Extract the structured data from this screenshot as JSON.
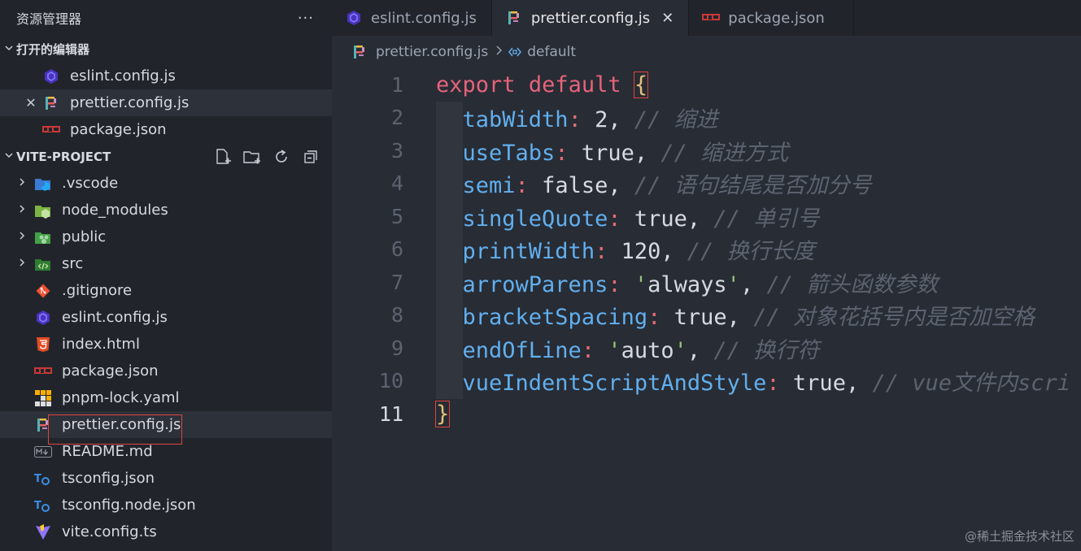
{
  "sidebar": {
    "title": "资源管理器",
    "more": "···",
    "open_editors": {
      "label": "打开的编辑器",
      "items": [
        {
          "name": "eslint.config.js",
          "icon": "eslint-icon"
        },
        {
          "name": "prettier.config.js",
          "icon": "prettier-icon",
          "active": true,
          "close": "✕"
        },
        {
          "name": "package.json",
          "icon": "npm-icon"
        }
      ]
    },
    "project": {
      "label": "VITE-PROJECT",
      "items": [
        {
          "name": ".vscode",
          "type": "folder",
          "icon": "vscode-folder-icon"
        },
        {
          "name": "node_modules",
          "type": "folder",
          "icon": "node-folder-icon"
        },
        {
          "name": "public",
          "type": "folder",
          "icon": "public-folder-icon"
        },
        {
          "name": "src",
          "type": "folder",
          "icon": "src-folder-icon"
        },
        {
          "name": ".gitignore",
          "type": "file",
          "icon": "git-icon"
        },
        {
          "name": "eslint.config.js",
          "type": "file",
          "icon": "eslint-icon"
        },
        {
          "name": "index.html",
          "type": "file",
          "icon": "html5-icon"
        },
        {
          "name": "package.json",
          "type": "file",
          "icon": "npm-icon"
        },
        {
          "name": "pnpm-lock.yaml",
          "type": "file",
          "icon": "pnpm-icon"
        },
        {
          "name": "prettier.config.js",
          "type": "file",
          "icon": "prettier-icon"
        },
        {
          "name": "README.md",
          "type": "file",
          "icon": "markdown-icon"
        },
        {
          "name": "tsconfig.json",
          "type": "file",
          "icon": "tsconfig-icon"
        },
        {
          "name": "tsconfig.node.json",
          "type": "file",
          "icon": "tsconfig-icon"
        },
        {
          "name": "vite.config.ts",
          "type": "file",
          "icon": "vite-icon"
        }
      ]
    }
  },
  "tabs": [
    {
      "name": "eslint.config.js",
      "icon": "eslint-icon"
    },
    {
      "name": "prettier.config.js",
      "icon": "prettier-icon",
      "active": true,
      "close": "✕"
    },
    {
      "name": "package.json",
      "icon": "npm-icon"
    }
  ],
  "breadcrumb": {
    "file": "prettier.config.js",
    "symbol": "default"
  },
  "code": {
    "lines": [
      {
        "n": "1"
      },
      {
        "n": "2"
      },
      {
        "n": "3"
      },
      {
        "n": "4"
      },
      {
        "n": "5"
      },
      {
        "n": "6"
      },
      {
        "n": "7"
      },
      {
        "n": "8"
      },
      {
        "n": "9"
      },
      {
        "n": "10"
      },
      {
        "n": "11"
      }
    ],
    "l1": {
      "kw1": "export",
      "kw2": "default",
      "brace": "{"
    },
    "l2": {
      "key": "tabWidth",
      "val": "2",
      "com": "// 缩进"
    },
    "l3": {
      "key": "useTabs",
      "val": "true",
      "com": "// 缩进方式"
    },
    "l4": {
      "key": "semi",
      "val": "false",
      "com": "// 语句结尾是否加分号"
    },
    "l5": {
      "key": "singleQuote",
      "val": "true",
      "com": "// 单引号"
    },
    "l6": {
      "key": "printWidth",
      "val": "120",
      "com": "// 换行长度"
    },
    "l7": {
      "key": "arrowParens",
      "val": "always",
      "com": "// 箭头函数参数"
    },
    "l8": {
      "key": "bracketSpacing",
      "val": "true",
      "com": "// 对象花括号内是否加空格"
    },
    "l9": {
      "key": "endOfLine",
      "val": "auto",
      "com": "// 换行符"
    },
    "l10": {
      "key": "vueIndentScriptAndStyle",
      "val": "true",
      "com": "// vue文件内scri"
    },
    "l11": {
      "brace": "}"
    }
  },
  "watermark": "@稀土掘金技术社区",
  "colors": {
    "eslint": "#4b32c3",
    "npm": "#cb3837",
    "prettier": "#c596c7",
    "html5": "#e44d26",
    "git": "#f05133",
    "ts": "#3178c6",
    "vite": "#a259ff",
    "highlight": "#e0443c"
  }
}
